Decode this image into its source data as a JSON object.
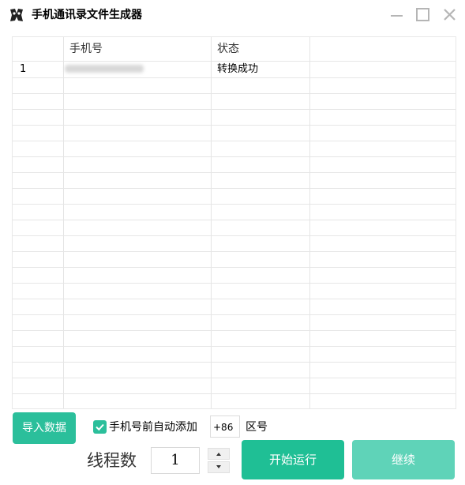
{
  "window": {
    "title": "手机通讯录文件生成器"
  },
  "grid": {
    "columns": [
      "",
      "手机号",
      "状态",
      ""
    ],
    "rows": [
      {
        "index": "1",
        "phone": "",
        "status": "转换成功"
      }
    ]
  },
  "controls": {
    "import_label": "导入数据",
    "auto_add_label": "手机号前自动添加",
    "auto_add_checked": true,
    "area_code_value": "+86",
    "area_code_label": "区号",
    "threads_label": "线程数",
    "threads_value": "1",
    "start_label": "开始运行",
    "continue_label": "继续"
  },
  "colors": {
    "accent": "#1fbf95",
    "accent_light": "#5fd3b8"
  }
}
